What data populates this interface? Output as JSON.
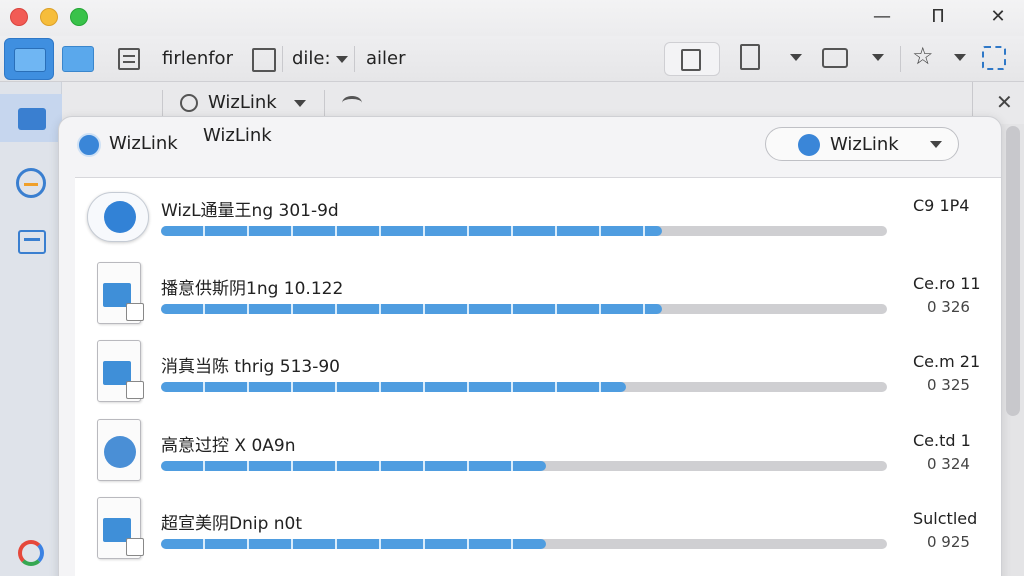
{
  "window": {
    "minimize": "—",
    "maximize": "Π",
    "close": "✕"
  },
  "toolbar": {
    "path_segment_1": "firlenfor",
    "path_segment_2": "dile:",
    "path_segment_3": "ailer"
  },
  "tabbar": {
    "tab_label": "WizLink",
    "close": "✕"
  },
  "panel": {
    "left_title": "WizLink",
    "center_title": "WizLink",
    "selector_label": "WizLink"
  },
  "rows": [
    {
      "title": "WizL通量王ng 301-9d",
      "stat": "C9 1P4",
      "sub": "",
      "progress": 0.69,
      "icon": "wizlink-app-icon"
    },
    {
      "title": "播意供斯阴1ng 10.122",
      "stat": "Ce.ro 11",
      "sub": "0 326",
      "progress": 0.69,
      "icon": "file-arrow-icon"
    },
    {
      "title": "消真当陈 thrig 513-90",
      "stat": "Ce.m 21",
      "sub": "0 325",
      "progress": 0.64,
      "icon": "file-arrow-icon"
    },
    {
      "title": "高意过控 X 0A9n",
      "stat": "Ce.td 1",
      "sub": "0 324",
      "progress": 0.53,
      "icon": "file-code-icon"
    },
    {
      "title": "超宣美阴Dnip n0t",
      "stat": "Sulctled",
      "sub": "0 925",
      "progress": 0.53,
      "icon": "file-arrow-icon"
    }
  ],
  "colors": {
    "accent": "#3f8fe0",
    "progress": "#4f9de0",
    "track": "#cfcfd2"
  }
}
